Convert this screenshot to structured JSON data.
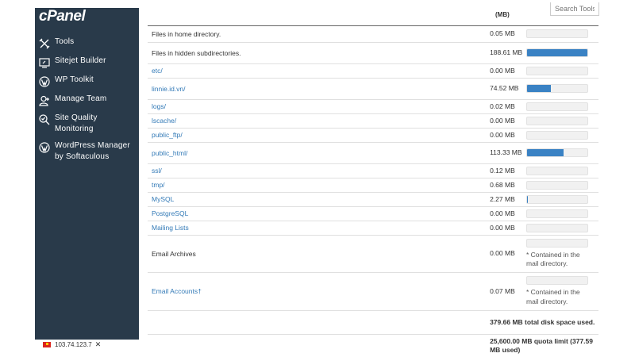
{
  "sidebar": {
    "logo": "cPanel",
    "items": [
      {
        "label": "Tools",
        "icon": "tools-icon"
      },
      {
        "label": "Sitejet Builder",
        "icon": "sitejet-icon"
      },
      {
        "label": "WP Toolkit",
        "icon": "wordpress-icon"
      },
      {
        "label": "Manage Team",
        "icon": "manage-team-icon"
      },
      {
        "label": "Site Quality Monitoring",
        "icon": "site-quality-icon"
      },
      {
        "label": "WordPress Manager by Softaculous",
        "icon": "wordpress-icon"
      }
    ],
    "ip_address": "103.74.123.7",
    "ip_close": "✕"
  },
  "search": {
    "placeholder": "Search Tools"
  },
  "table": {
    "size_header": "(MB)",
    "rows": [
      {
        "name": "Files in home directory.",
        "link": false,
        "size": "0.05 MB",
        "usage": 0
      },
      {
        "name": "Files in hidden subdirectories.",
        "link": false,
        "size": "188.61 MB",
        "usage": 100
      },
      {
        "name": "etc/",
        "link": true,
        "size": "0.00 MB",
        "usage": 0
      },
      {
        "name": "linnie.id.vn/",
        "link": true,
        "size": "74.52 MB",
        "usage": 39.5
      },
      {
        "name": "logs/",
        "link": true,
        "size": "0.02 MB",
        "usage": 0
      },
      {
        "name": "lscache/",
        "link": true,
        "size": "0.00 MB",
        "usage": 0
      },
      {
        "name": "public_ftp/",
        "link": true,
        "size": "0.00 MB",
        "usage": 0
      },
      {
        "name": "public_html/",
        "link": true,
        "size": "113.33 MB",
        "usage": 60
      },
      {
        "name": "ssl/",
        "link": true,
        "size": "0.12 MB",
        "usage": 0
      },
      {
        "name": "tmp/",
        "link": true,
        "size": "0.68 MB",
        "usage": 0
      },
      {
        "name": "MySQL",
        "link": true,
        "size": "2.27 MB",
        "usage": 1.2
      },
      {
        "name": "PostgreSQL",
        "link": true,
        "size": "0.00 MB",
        "usage": 0
      },
      {
        "name": "Mailing Lists",
        "link": true,
        "size": "0.00 MB",
        "usage": 0
      },
      {
        "name": "Email Archives",
        "link": false,
        "size": "0.00 MB",
        "usage": 0,
        "note": "* Contained in the mail directory."
      },
      {
        "name": "Email Accounts†",
        "link": true,
        "size": "0.07 MB",
        "usage": 0,
        "note": "* Contained in the mail directory."
      }
    ],
    "total": "379.66 MB total disk space used.",
    "quota": "25,600.00 MB quota limit (377.59 MB used)"
  },
  "colors": {
    "sidebar_bg": "#293a4a",
    "link": "#337ab7",
    "bar_fill": "#3a82c4"
  }
}
